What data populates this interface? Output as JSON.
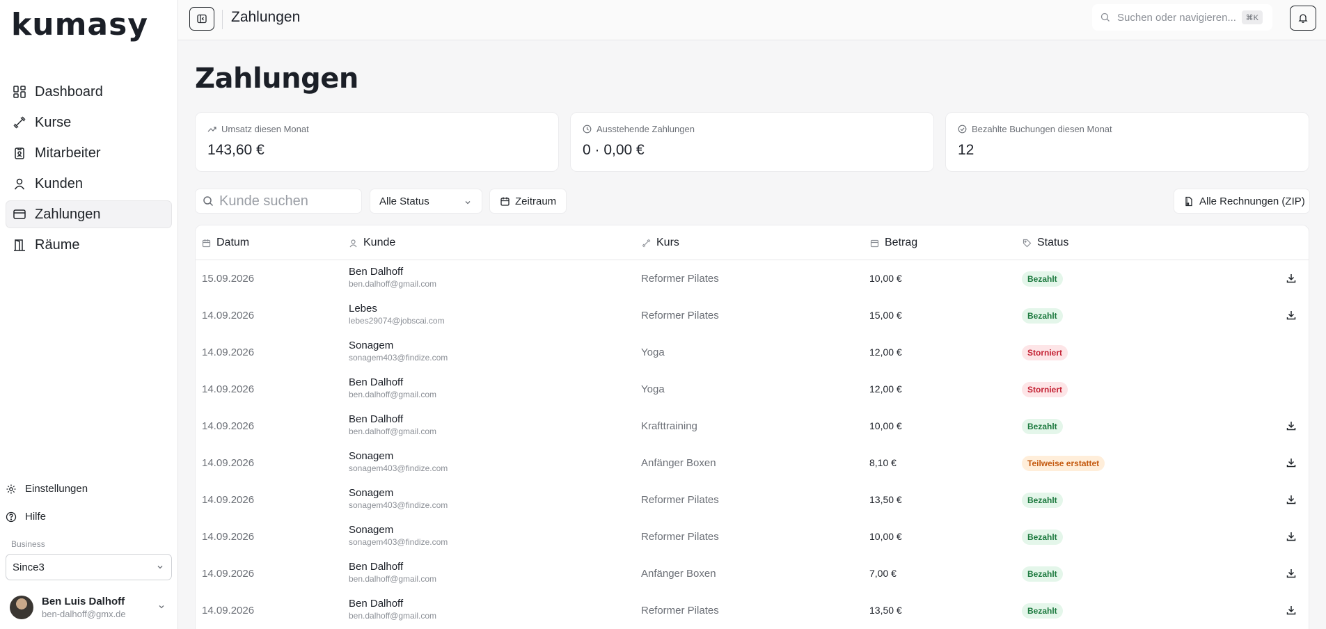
{
  "brand": {
    "logo_text": "kumasy"
  },
  "sidebar": {
    "items": [
      {
        "label": "Dashboard",
        "icon": "dashboard-icon",
        "active": false
      },
      {
        "label": "Kurse",
        "icon": "dumbbell-icon",
        "active": false
      },
      {
        "label": "Mitarbeiter",
        "icon": "badge-icon",
        "active": false
      },
      {
        "label": "Kunden",
        "icon": "user-icon",
        "active": false
      },
      {
        "label": "Zahlungen",
        "icon": "credit-card-icon",
        "active": true
      },
      {
        "label": "Räume",
        "icon": "door-icon",
        "active": false
      }
    ],
    "settings_label": "Einstellungen",
    "help_label": "Hilfe",
    "business_label": "Business",
    "business_value": "Since3",
    "user_name": "Ben Luis Dalhoff",
    "user_email": "ben-dalhoff@gmx.de"
  },
  "header": {
    "title": "Zahlungen",
    "search_placeholder": "Suchen oder navigieren...",
    "shortcut": "⌘K"
  },
  "main": {
    "title": "Zahlungen",
    "stats": [
      {
        "label": "Umsatz diesen Monat",
        "value": "143,60 €",
        "icon": "trending-up-icon"
      },
      {
        "label": "Ausstehende Zahlungen",
        "value": "0 · 0,00 €",
        "icon": "clock-icon"
      },
      {
        "label": "Bezahlte Buchungen diesen Monat",
        "value": "12",
        "icon": "check-circle-icon"
      }
    ],
    "filters": {
      "search_placeholder": "Kunde suchen",
      "status_value": "Alle Status",
      "time_label": "Zeitraum",
      "zip_label": "Alle Rechnungen (ZIP)"
    }
  },
  "table": {
    "headers": {
      "date": "Datum",
      "customer": "Kunde",
      "course": "Kurs",
      "amount": "Betrag",
      "status": "Status"
    },
    "rows": [
      {
        "date": "15.09.2026",
        "name": "Ben Dalhoff",
        "email": "ben.dalhoff@gmail.com",
        "course": "Reformer Pilates",
        "amount": "10,00 €",
        "status": "Bezahlt",
        "status_type": "paid",
        "download": true
      },
      {
        "date": "14.09.2026",
        "name": "Lebes",
        "email": "lebes29074@jobscai.com",
        "course": "Reformer Pilates",
        "amount": "15,00 €",
        "status": "Bezahlt",
        "status_type": "paid",
        "download": true
      },
      {
        "date": "14.09.2026",
        "name": "Sonagem",
        "email": "sonagem403@findize.com",
        "course": "Yoga",
        "amount": "12,00 €",
        "status": "Storniert",
        "status_type": "cancel",
        "download": false
      },
      {
        "date": "14.09.2026",
        "name": "Ben Dalhoff",
        "email": "ben.dalhoff@gmail.com",
        "course": "Yoga",
        "amount": "12,00 €",
        "status": "Storniert",
        "status_type": "cancel",
        "download": false
      },
      {
        "date": "14.09.2026",
        "name": "Ben Dalhoff",
        "email": "ben.dalhoff@gmail.com",
        "course": "Krafttraining",
        "amount": "10,00 €",
        "status": "Bezahlt",
        "status_type": "paid",
        "download": true
      },
      {
        "date": "14.09.2026",
        "name": "Sonagem",
        "email": "sonagem403@findize.com",
        "course": "Anfänger Boxen",
        "amount": "8,10 €",
        "status": "Teilweise erstattet",
        "status_type": "partial",
        "download": true
      },
      {
        "date": "14.09.2026",
        "name": "Sonagem",
        "email": "sonagem403@findize.com",
        "course": "Reformer Pilates",
        "amount": "13,50 €",
        "status": "Bezahlt",
        "status_type": "paid",
        "download": true
      },
      {
        "date": "14.09.2026",
        "name": "Sonagem",
        "email": "sonagem403@findize.com",
        "course": "Reformer Pilates",
        "amount": "10,00 €",
        "status": "Bezahlt",
        "status_type": "paid",
        "download": true
      },
      {
        "date": "14.09.2026",
        "name": "Ben Dalhoff",
        "email": "ben.dalhoff@gmail.com",
        "course": "Anfänger Boxen",
        "amount": "7,00 €",
        "status": "Bezahlt",
        "status_type": "paid",
        "download": true
      },
      {
        "date": "14.09.2026",
        "name": "Ben Dalhoff",
        "email": "ben.dalhoff@gmail.com",
        "course": "Reformer Pilates",
        "amount": "13,50 €",
        "status": "Bezahlt",
        "status_type": "paid",
        "download": true
      }
    ]
  },
  "colors": {
    "paid": "#1d7a3f",
    "cancel": "#c42335",
    "partial": "#c45a10"
  }
}
